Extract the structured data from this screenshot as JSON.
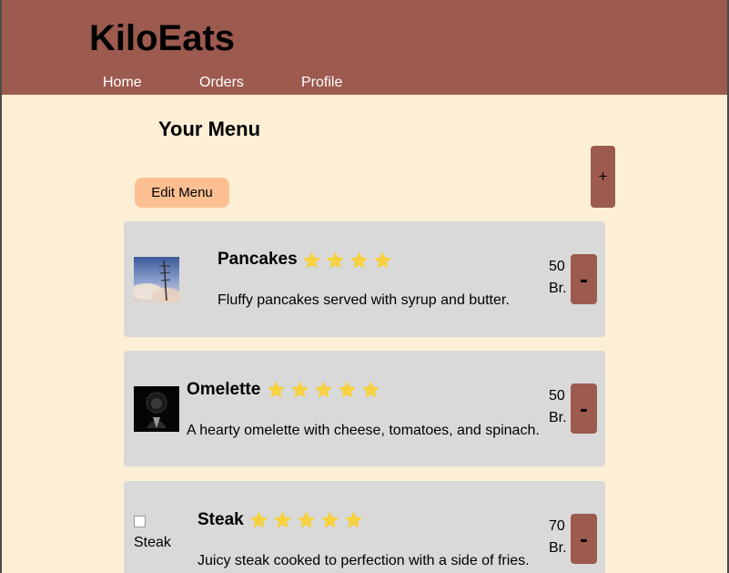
{
  "header": {
    "brand": "KiloEats",
    "nav": [
      "Home",
      "Orders",
      "Profile"
    ]
  },
  "main": {
    "title": "Your Menu",
    "add_label": "+",
    "edit_label": "Edit Menu"
  },
  "menu_items": [
    {
      "name": "Pancakes",
      "rating": 4,
      "description": "Fluffy pancakes served with syrup and butter.",
      "price_amount": "50",
      "price_currency": "Br.",
      "remove_label": "-"
    },
    {
      "name": "Omelette",
      "rating": 5,
      "description": "A hearty omelette with cheese, tomatoes, and spinach.",
      "price_amount": "50",
      "price_currency": "Br.",
      "remove_label": "-"
    },
    {
      "name": "Steak",
      "rating": 5,
      "description": "Juicy steak cooked to perfection with a side of fries.",
      "price_amount": "70",
      "price_currency": "Br.",
      "image_alt": "Steak",
      "remove_label": "-"
    }
  ],
  "colors": {
    "header_bg": "#9d5a4f",
    "page_bg": "#fdefd5",
    "card_bg": "#d9d9d9",
    "edit_button_bg": "#fcbf92",
    "star": "#f7d13f"
  }
}
